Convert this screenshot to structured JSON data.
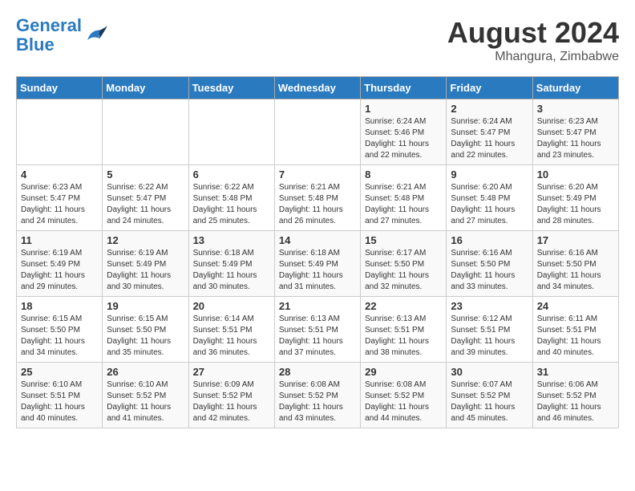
{
  "header": {
    "logo_line1": "General",
    "logo_line2": "Blue",
    "month_year": "August 2024",
    "location": "Mhangura, Zimbabwe"
  },
  "days_of_week": [
    "Sunday",
    "Monday",
    "Tuesday",
    "Wednesday",
    "Thursday",
    "Friday",
    "Saturday"
  ],
  "weeks": [
    [
      {
        "day": "",
        "info": ""
      },
      {
        "day": "",
        "info": ""
      },
      {
        "day": "",
        "info": ""
      },
      {
        "day": "",
        "info": ""
      },
      {
        "day": "1",
        "info": "Sunrise: 6:24 AM\nSunset: 5:46 PM\nDaylight: 11 hours\nand 22 minutes."
      },
      {
        "day": "2",
        "info": "Sunrise: 6:24 AM\nSunset: 5:47 PM\nDaylight: 11 hours\nand 22 minutes."
      },
      {
        "day": "3",
        "info": "Sunrise: 6:23 AM\nSunset: 5:47 PM\nDaylight: 11 hours\nand 23 minutes."
      }
    ],
    [
      {
        "day": "4",
        "info": "Sunrise: 6:23 AM\nSunset: 5:47 PM\nDaylight: 11 hours\nand 24 minutes."
      },
      {
        "day": "5",
        "info": "Sunrise: 6:22 AM\nSunset: 5:47 PM\nDaylight: 11 hours\nand 24 minutes."
      },
      {
        "day": "6",
        "info": "Sunrise: 6:22 AM\nSunset: 5:48 PM\nDaylight: 11 hours\nand 25 minutes."
      },
      {
        "day": "7",
        "info": "Sunrise: 6:21 AM\nSunset: 5:48 PM\nDaylight: 11 hours\nand 26 minutes."
      },
      {
        "day": "8",
        "info": "Sunrise: 6:21 AM\nSunset: 5:48 PM\nDaylight: 11 hours\nand 27 minutes."
      },
      {
        "day": "9",
        "info": "Sunrise: 6:20 AM\nSunset: 5:48 PM\nDaylight: 11 hours\nand 27 minutes."
      },
      {
        "day": "10",
        "info": "Sunrise: 6:20 AM\nSunset: 5:49 PM\nDaylight: 11 hours\nand 28 minutes."
      }
    ],
    [
      {
        "day": "11",
        "info": "Sunrise: 6:19 AM\nSunset: 5:49 PM\nDaylight: 11 hours\nand 29 minutes."
      },
      {
        "day": "12",
        "info": "Sunrise: 6:19 AM\nSunset: 5:49 PM\nDaylight: 11 hours\nand 30 minutes."
      },
      {
        "day": "13",
        "info": "Sunrise: 6:18 AM\nSunset: 5:49 PM\nDaylight: 11 hours\nand 30 minutes."
      },
      {
        "day": "14",
        "info": "Sunrise: 6:18 AM\nSunset: 5:49 PM\nDaylight: 11 hours\nand 31 minutes."
      },
      {
        "day": "15",
        "info": "Sunrise: 6:17 AM\nSunset: 5:50 PM\nDaylight: 11 hours\nand 32 minutes."
      },
      {
        "day": "16",
        "info": "Sunrise: 6:16 AM\nSunset: 5:50 PM\nDaylight: 11 hours\nand 33 minutes."
      },
      {
        "day": "17",
        "info": "Sunrise: 6:16 AM\nSunset: 5:50 PM\nDaylight: 11 hours\nand 34 minutes."
      }
    ],
    [
      {
        "day": "18",
        "info": "Sunrise: 6:15 AM\nSunset: 5:50 PM\nDaylight: 11 hours\nand 34 minutes."
      },
      {
        "day": "19",
        "info": "Sunrise: 6:15 AM\nSunset: 5:50 PM\nDaylight: 11 hours\nand 35 minutes."
      },
      {
        "day": "20",
        "info": "Sunrise: 6:14 AM\nSunset: 5:51 PM\nDaylight: 11 hours\nand 36 minutes."
      },
      {
        "day": "21",
        "info": "Sunrise: 6:13 AM\nSunset: 5:51 PM\nDaylight: 11 hours\nand 37 minutes."
      },
      {
        "day": "22",
        "info": "Sunrise: 6:13 AM\nSunset: 5:51 PM\nDaylight: 11 hours\nand 38 minutes."
      },
      {
        "day": "23",
        "info": "Sunrise: 6:12 AM\nSunset: 5:51 PM\nDaylight: 11 hours\nand 39 minutes."
      },
      {
        "day": "24",
        "info": "Sunrise: 6:11 AM\nSunset: 5:51 PM\nDaylight: 11 hours\nand 40 minutes."
      }
    ],
    [
      {
        "day": "25",
        "info": "Sunrise: 6:10 AM\nSunset: 5:51 PM\nDaylight: 11 hours\nand 40 minutes."
      },
      {
        "day": "26",
        "info": "Sunrise: 6:10 AM\nSunset: 5:52 PM\nDaylight: 11 hours\nand 41 minutes."
      },
      {
        "day": "27",
        "info": "Sunrise: 6:09 AM\nSunset: 5:52 PM\nDaylight: 11 hours\nand 42 minutes."
      },
      {
        "day": "28",
        "info": "Sunrise: 6:08 AM\nSunset: 5:52 PM\nDaylight: 11 hours\nand 43 minutes."
      },
      {
        "day": "29",
        "info": "Sunrise: 6:08 AM\nSunset: 5:52 PM\nDaylight: 11 hours\nand 44 minutes."
      },
      {
        "day": "30",
        "info": "Sunrise: 6:07 AM\nSunset: 5:52 PM\nDaylight: 11 hours\nand 45 minutes."
      },
      {
        "day": "31",
        "info": "Sunrise: 6:06 AM\nSunset: 5:52 PM\nDaylight: 11 hours\nand 46 minutes."
      }
    ]
  ]
}
